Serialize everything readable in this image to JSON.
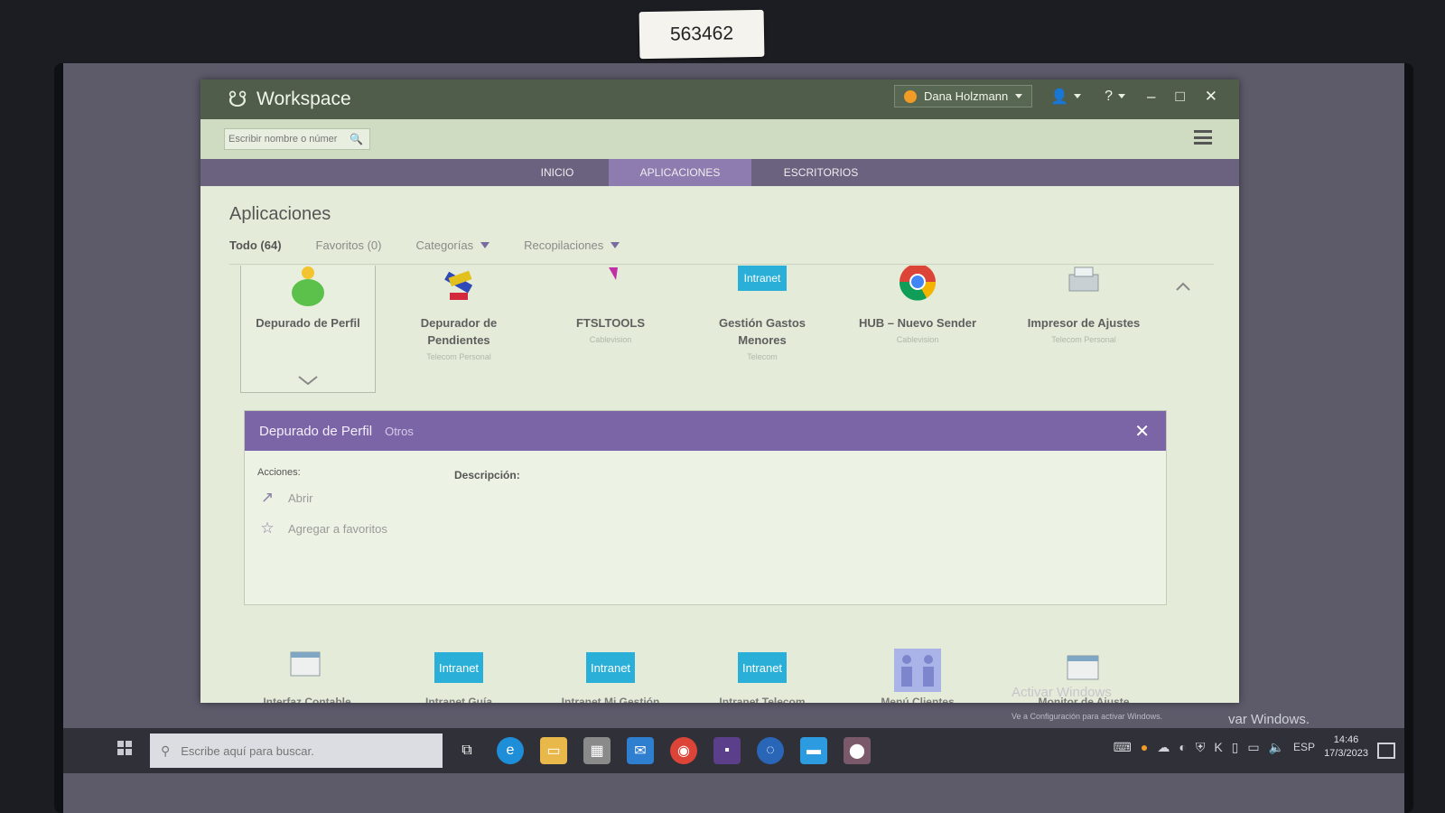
{
  "sticker": "563462",
  "window": {
    "title": "Workspace",
    "user_name": "Dana Holzmann",
    "help_icon": "?",
    "controls": {
      "minimize": "–",
      "maximize": "□",
      "close": "✕"
    }
  },
  "search": {
    "placeholder": "Escribir nombre o númer"
  },
  "nav": {
    "tabs": [
      "INICIO",
      "APLICACIONES",
      "ESCRITORIOS"
    ],
    "active": "APLICACIONES"
  },
  "page": {
    "title": "Aplicaciones",
    "filters": {
      "all": "Todo (64)",
      "favorites": "Favoritos (0)",
      "categories": "Categorías",
      "collections": "Recopilaciones"
    }
  },
  "apps_top": [
    {
      "name": "Depurado de Perfil",
      "category": ""
    },
    {
      "name": "Depurador de Pendientes",
      "category": "Telecom Personal"
    },
    {
      "name": "FTSLTOOLS",
      "category": "Cablevision"
    },
    {
      "name": "Gestión Gastos Menores",
      "category": "Telecom"
    },
    {
      "name": "HUB – Nuevo Sender",
      "category": "Cablevision"
    },
    {
      "name": "Impresor de Ajustes",
      "category": "Telecom Personal"
    }
  ],
  "detail": {
    "title": "Depurado de Perfil",
    "category": "Otros",
    "close": "✕",
    "actions_label": "Acciones:",
    "description_label": "Descripción:",
    "actions": {
      "open": "Abrir",
      "add_favorite": "Agregar a favoritos"
    }
  },
  "apps_bottom": [
    {
      "name": "Interfaz Contable",
      "icon_text": ""
    },
    {
      "name": "Intranet Guía",
      "icon_text": "Intranet"
    },
    {
      "name": "Intranet Mi Gestión",
      "icon_text": "Intranet"
    },
    {
      "name": "Intranet Telecom",
      "icon_text": "Intranet"
    },
    {
      "name": "Menú Clientes",
      "icon_text": ""
    },
    {
      "name": "Monitor de Ajuste",
      "icon_text": ""
    }
  ],
  "watermark": {
    "title": "Activar Windows",
    "subtitle": "Ve a Configuración para activar Windows.",
    "tail": "var Windows."
  },
  "taskbar": {
    "search_placeholder": "Escribe aquí para buscar.",
    "language": "ESP",
    "time": "14:46",
    "date": "17/3/2023"
  },
  "colors": {
    "accent_purple": "#7b65a6",
    "title_bar": "#4f5d4a",
    "intranet_blue": "#2ab0d8"
  }
}
